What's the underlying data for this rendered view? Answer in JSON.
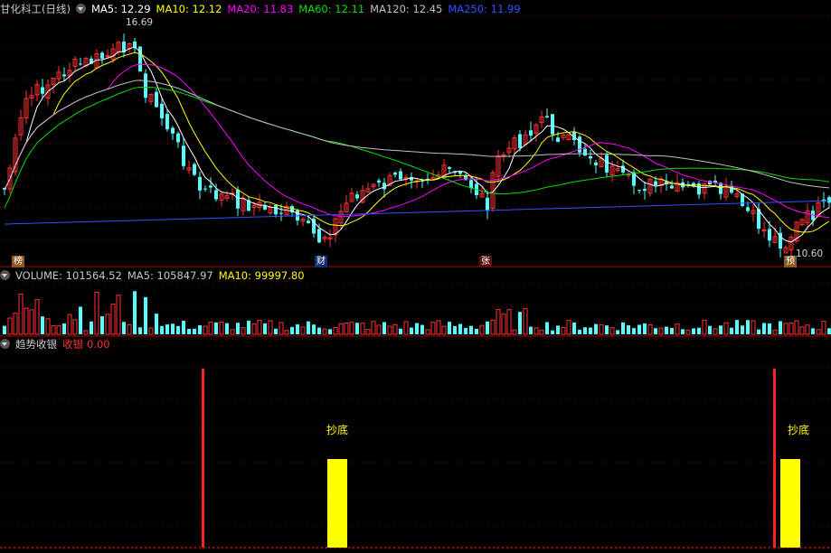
{
  "title": "甘化科工(日线)",
  "ma": [
    {
      "label": "MA5: 12.29",
      "color": "#ffffff"
    },
    {
      "label": "MA10: 12.12",
      "color": "#ffff00"
    },
    {
      "label": "MA20: 11.83",
      "color": "#ff00ff"
    },
    {
      "label": "MA60: 12.11",
      "color": "#00e000"
    },
    {
      "label": "MA120: 12.45",
      "color": "#c0c0c0"
    },
    {
      "label": "MA250: 11.99",
      "color": "#3050ff"
    }
  ],
  "price": {
    "high_label": "16.69",
    "low_label": "10.60",
    "high": 16.69,
    "low": 10.6
  },
  "markers": [
    {
      "id": "bang",
      "text": "榜",
      "bg": "#8a5a20",
      "color": "#ffffff"
    },
    {
      "id": "cai",
      "text": "财",
      "bg": "#103070",
      "color": "#ffffff"
    },
    {
      "id": "zhang",
      "text": "张",
      "bg": "#601010",
      "color": "#ffffff"
    },
    {
      "id": "yu",
      "text": "预",
      "bg": "#8a5a20",
      "color": "#ffffff"
    }
  ],
  "volume": {
    "label": "VOLUME: 101564.52",
    "ma5": "MA5: 105847.97",
    "ma10": "MA10: 99997.80"
  },
  "indicator": {
    "name": "趋势收银",
    "sub": "收银",
    "value": "0.00",
    "signal_text": "抄底"
  },
  "colors": {
    "up": "#ff3232",
    "down": "#54ffff",
    "grid": "#7a0000",
    "axis": "#b00000"
  }
}
